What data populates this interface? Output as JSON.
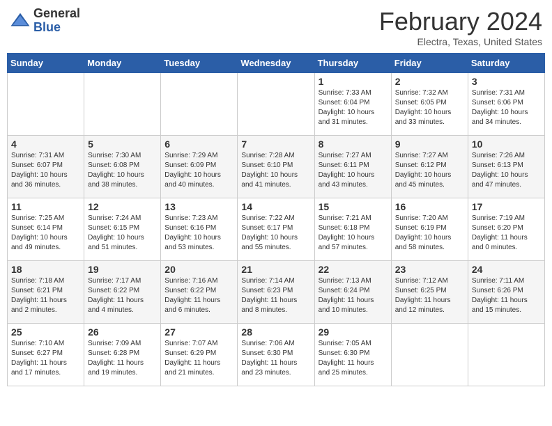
{
  "header": {
    "logo_general": "General",
    "logo_blue": "Blue",
    "month_title": "February 2024",
    "location": "Electra, Texas, United States"
  },
  "weekdays": [
    "Sunday",
    "Monday",
    "Tuesday",
    "Wednesday",
    "Thursday",
    "Friday",
    "Saturday"
  ],
  "weeks": [
    [
      {
        "day": "",
        "info": ""
      },
      {
        "day": "",
        "info": ""
      },
      {
        "day": "",
        "info": ""
      },
      {
        "day": "",
        "info": ""
      },
      {
        "day": "1",
        "info": "Sunrise: 7:33 AM\nSunset: 6:04 PM\nDaylight: 10 hours\nand 31 minutes."
      },
      {
        "day": "2",
        "info": "Sunrise: 7:32 AM\nSunset: 6:05 PM\nDaylight: 10 hours\nand 33 minutes."
      },
      {
        "day": "3",
        "info": "Sunrise: 7:31 AM\nSunset: 6:06 PM\nDaylight: 10 hours\nand 34 minutes."
      }
    ],
    [
      {
        "day": "4",
        "info": "Sunrise: 7:31 AM\nSunset: 6:07 PM\nDaylight: 10 hours\nand 36 minutes."
      },
      {
        "day": "5",
        "info": "Sunrise: 7:30 AM\nSunset: 6:08 PM\nDaylight: 10 hours\nand 38 minutes."
      },
      {
        "day": "6",
        "info": "Sunrise: 7:29 AM\nSunset: 6:09 PM\nDaylight: 10 hours\nand 40 minutes."
      },
      {
        "day": "7",
        "info": "Sunrise: 7:28 AM\nSunset: 6:10 PM\nDaylight: 10 hours\nand 41 minutes."
      },
      {
        "day": "8",
        "info": "Sunrise: 7:27 AM\nSunset: 6:11 PM\nDaylight: 10 hours\nand 43 minutes."
      },
      {
        "day": "9",
        "info": "Sunrise: 7:27 AM\nSunset: 6:12 PM\nDaylight: 10 hours\nand 45 minutes."
      },
      {
        "day": "10",
        "info": "Sunrise: 7:26 AM\nSunset: 6:13 PM\nDaylight: 10 hours\nand 47 minutes."
      }
    ],
    [
      {
        "day": "11",
        "info": "Sunrise: 7:25 AM\nSunset: 6:14 PM\nDaylight: 10 hours\nand 49 minutes."
      },
      {
        "day": "12",
        "info": "Sunrise: 7:24 AM\nSunset: 6:15 PM\nDaylight: 10 hours\nand 51 minutes."
      },
      {
        "day": "13",
        "info": "Sunrise: 7:23 AM\nSunset: 6:16 PM\nDaylight: 10 hours\nand 53 minutes."
      },
      {
        "day": "14",
        "info": "Sunrise: 7:22 AM\nSunset: 6:17 PM\nDaylight: 10 hours\nand 55 minutes."
      },
      {
        "day": "15",
        "info": "Sunrise: 7:21 AM\nSunset: 6:18 PM\nDaylight: 10 hours\nand 57 minutes."
      },
      {
        "day": "16",
        "info": "Sunrise: 7:20 AM\nSunset: 6:19 PM\nDaylight: 10 hours\nand 58 minutes."
      },
      {
        "day": "17",
        "info": "Sunrise: 7:19 AM\nSunset: 6:20 PM\nDaylight: 11 hours\nand 0 minutes."
      }
    ],
    [
      {
        "day": "18",
        "info": "Sunrise: 7:18 AM\nSunset: 6:21 PM\nDaylight: 11 hours\nand 2 minutes."
      },
      {
        "day": "19",
        "info": "Sunrise: 7:17 AM\nSunset: 6:22 PM\nDaylight: 11 hours\nand 4 minutes."
      },
      {
        "day": "20",
        "info": "Sunrise: 7:16 AM\nSunset: 6:22 PM\nDaylight: 11 hours\nand 6 minutes."
      },
      {
        "day": "21",
        "info": "Sunrise: 7:14 AM\nSunset: 6:23 PM\nDaylight: 11 hours\nand 8 minutes."
      },
      {
        "day": "22",
        "info": "Sunrise: 7:13 AM\nSunset: 6:24 PM\nDaylight: 11 hours\nand 10 minutes."
      },
      {
        "day": "23",
        "info": "Sunrise: 7:12 AM\nSunset: 6:25 PM\nDaylight: 11 hours\nand 12 minutes."
      },
      {
        "day": "24",
        "info": "Sunrise: 7:11 AM\nSunset: 6:26 PM\nDaylight: 11 hours\nand 15 minutes."
      }
    ],
    [
      {
        "day": "25",
        "info": "Sunrise: 7:10 AM\nSunset: 6:27 PM\nDaylight: 11 hours\nand 17 minutes."
      },
      {
        "day": "26",
        "info": "Sunrise: 7:09 AM\nSunset: 6:28 PM\nDaylight: 11 hours\nand 19 minutes."
      },
      {
        "day": "27",
        "info": "Sunrise: 7:07 AM\nSunset: 6:29 PM\nDaylight: 11 hours\nand 21 minutes."
      },
      {
        "day": "28",
        "info": "Sunrise: 7:06 AM\nSunset: 6:30 PM\nDaylight: 11 hours\nand 23 minutes."
      },
      {
        "day": "29",
        "info": "Sunrise: 7:05 AM\nSunset: 6:30 PM\nDaylight: 11 hours\nand 25 minutes."
      },
      {
        "day": "",
        "info": ""
      },
      {
        "day": "",
        "info": ""
      }
    ]
  ]
}
